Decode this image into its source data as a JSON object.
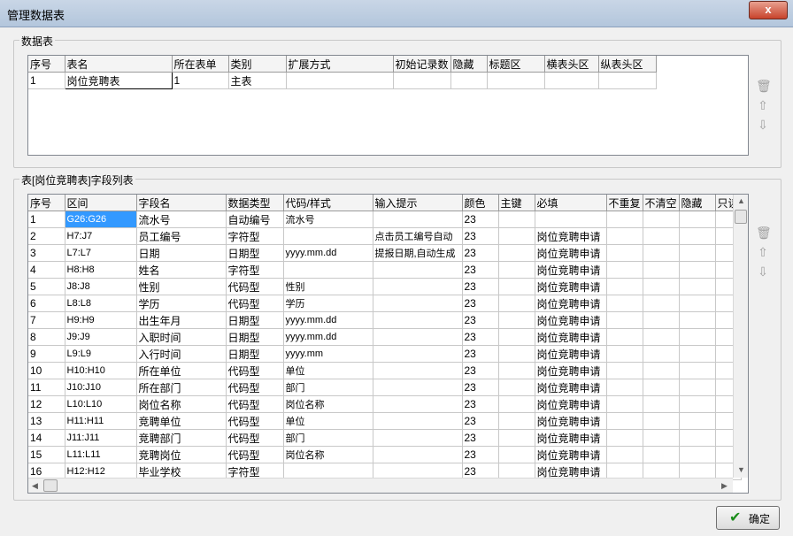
{
  "window": {
    "title": "管理数据表",
    "close_glyph": "x"
  },
  "tables_group": {
    "label": "数据表",
    "columns": [
      "序号",
      "表名",
      "所在表单",
      "类别",
      "扩展方式",
      "初始记录数",
      "隐藏",
      "标题区",
      "横表头区",
      "纵表头区"
    ],
    "rows": [
      [
        "1",
        "岗位竞聘表",
        "1",
        "主表",
        "",
        "",
        "",
        "",
        "",
        ""
      ]
    ]
  },
  "fields_group": {
    "label": "表[岗位竞聘表]字段列表",
    "columns": [
      "序号",
      "区间",
      "字段名",
      "数据类型",
      "代码/样式",
      "输入提示",
      "颜色",
      "主键",
      "必填",
      "不重复",
      "不清空",
      "隐藏",
      "只读"
    ],
    "rows": [
      [
        "1",
        "G26:G26",
        "流水号",
        "自动编号",
        "流水号",
        "",
        "23",
        "",
        "",
        "",
        "",
        "",
        ""
      ],
      [
        "2",
        "H7:J7",
        "员工编号",
        "字符型",
        "",
        "点击员工编号自动",
        "23",
        "",
        "岗位竞聘申请",
        "",
        "",
        "",
        ""
      ],
      [
        "3",
        "L7:L7",
        "日期",
        "日期型",
        "yyyy.mm.dd",
        "提报日期,自动生成",
        "23",
        "",
        "岗位竞聘申请",
        "",
        "",
        "",
        ""
      ],
      [
        "4",
        "H8:H8",
        "姓名",
        "字符型",
        "",
        "",
        "23",
        "",
        "岗位竞聘申请",
        "",
        "",
        "",
        ""
      ],
      [
        "5",
        "J8:J8",
        "性别",
        "代码型",
        "性别",
        "",
        "23",
        "",
        "岗位竞聘申请",
        "",
        "",
        "",
        ""
      ],
      [
        "6",
        "L8:L8",
        "学历",
        "代码型",
        "学历",
        "",
        "23",
        "",
        "岗位竞聘申请",
        "",
        "",
        "",
        ""
      ],
      [
        "7",
        "H9:H9",
        "出生年月",
        "日期型",
        "yyyy.mm.dd",
        "",
        "23",
        "",
        "岗位竞聘申请",
        "",
        "",
        "",
        ""
      ],
      [
        "8",
        "J9:J9",
        "入职时间",
        "日期型",
        "yyyy.mm.dd",
        "",
        "23",
        "",
        "岗位竞聘申请",
        "",
        "",
        "",
        ""
      ],
      [
        "9",
        "L9:L9",
        "入行时间",
        "日期型",
        "yyyy.mm",
        "",
        "23",
        "",
        "岗位竞聘申请",
        "",
        "",
        "",
        ""
      ],
      [
        "10",
        "H10:H10",
        "所在单位",
        "代码型",
        "单位",
        "",
        "23",
        "",
        "岗位竞聘申请",
        "",
        "",
        "",
        ""
      ],
      [
        "11",
        "J10:J10",
        "所在部门",
        "代码型",
        "部门",
        "",
        "23",
        "",
        "岗位竞聘申请",
        "",
        "",
        "",
        ""
      ],
      [
        "12",
        "L10:L10",
        "岗位名称",
        "代码型",
        "岗位名称",
        "",
        "23",
        "",
        "岗位竞聘申请",
        "",
        "",
        "",
        ""
      ],
      [
        "13",
        "H11:H11",
        "竞聘单位",
        "代码型",
        "单位",
        "",
        "23",
        "",
        "岗位竞聘申请",
        "",
        "",
        "",
        ""
      ],
      [
        "14",
        "J11:J11",
        "竞聘部门",
        "代码型",
        "部门",
        "",
        "23",
        "",
        "岗位竞聘申请",
        "",
        "",
        "",
        ""
      ],
      [
        "15",
        "L11:L11",
        "竞聘岗位",
        "代码型",
        "岗位名称",
        "",
        "23",
        "",
        "岗位竞聘申请",
        "",
        "",
        "",
        ""
      ],
      [
        "16",
        "H12:H12",
        "毕业学校",
        "字符型",
        "",
        "",
        "23",
        "",
        "岗位竞聘申请",
        "",
        "",
        "",
        ""
      ]
    ]
  },
  "side_icons": [
    "trash-icon",
    "arrow-up-icon",
    "arrow-down-icon"
  ],
  "ok_button": {
    "label": "确定"
  }
}
